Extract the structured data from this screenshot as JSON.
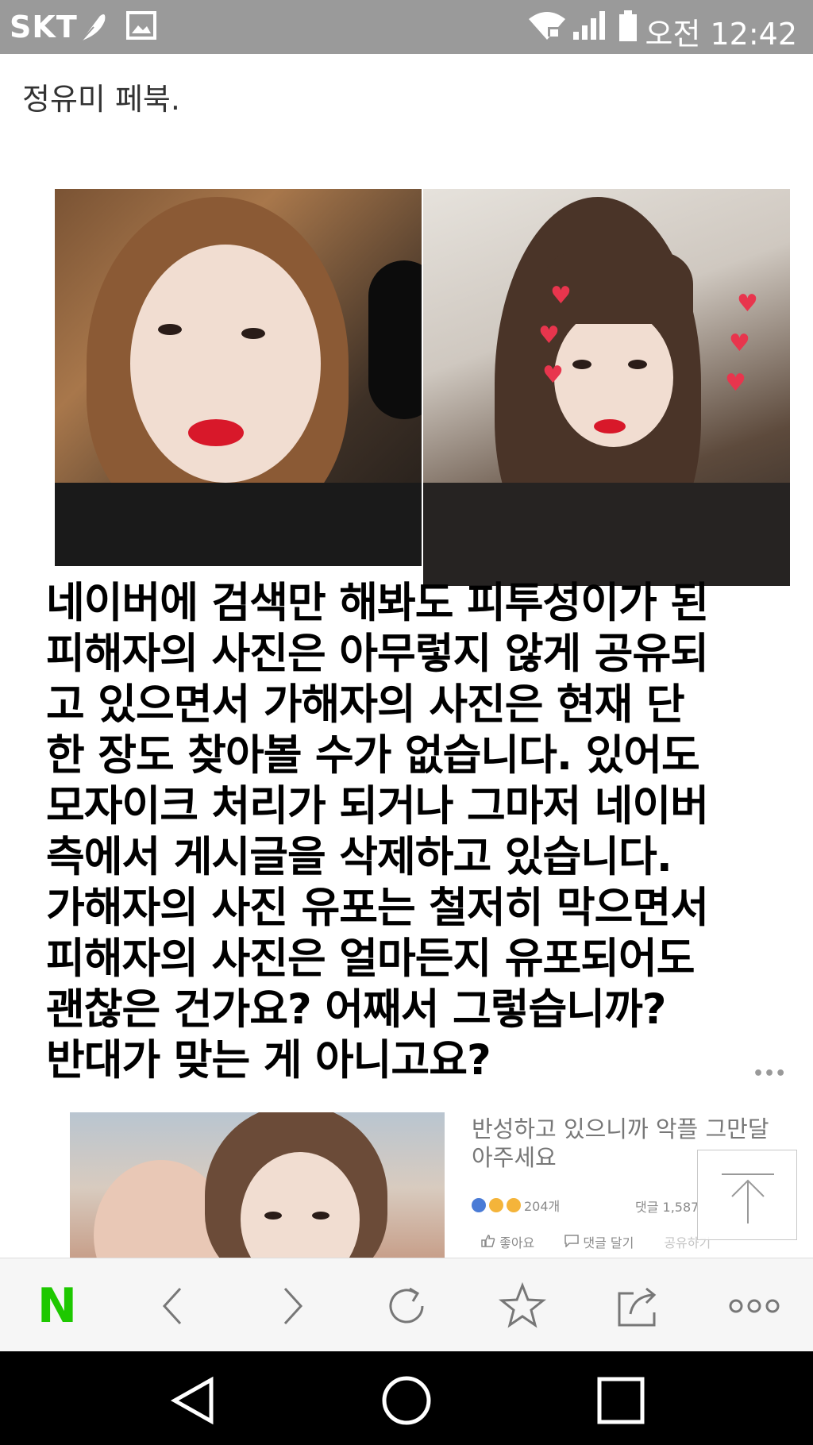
{
  "status_bar": {
    "carrier": "SKT",
    "time": "오전 12:42",
    "icons": [
      "feather-icon",
      "image-icon",
      "wifi-icon",
      "signal-icon",
      "battery-icon"
    ]
  },
  "post": {
    "title": "정유미 페북.",
    "main_text_lines": [
      "네이버에 검색만 해봐도 피투성이가 된",
      "피해자의 사진은 아무렇지 않게 공유되",
      "고 있으면서 가해자의 사진은 현재 단",
      "한 장도 찾아볼 수가 없습니다. 있어도",
      "모자이크 처리가 되거나 그마저 네이버",
      "측에서 게시글을 삭제하고 있습니다.",
      "가해자의 사진 유포는 철저히 막으면서",
      "피해자의 사진은 얼마든지 유포되어도",
      "괜찮은 건가요? 어째서 그렇습니까?",
      "반대가 맞는 게 아니고요?"
    ]
  },
  "fb_post": {
    "text_line1": "반성하고 있으니까 악플 그만달",
    "text_line2": "아주세요",
    "more": "•••",
    "reactions_count": "204개",
    "comments": "댓글 1,587",
    "like": "좋아요",
    "comment": "댓글 달기",
    "share": "공유하기"
  },
  "toolbar": {
    "home": "N",
    "buttons": [
      "back-icon",
      "forward-icon",
      "refresh-icon",
      "star-icon",
      "share-icon",
      "more-icon"
    ]
  },
  "colors": {
    "status_bg": "#9a9a9a",
    "naver_green": "#1ec800",
    "nav_bg": "#000000"
  }
}
